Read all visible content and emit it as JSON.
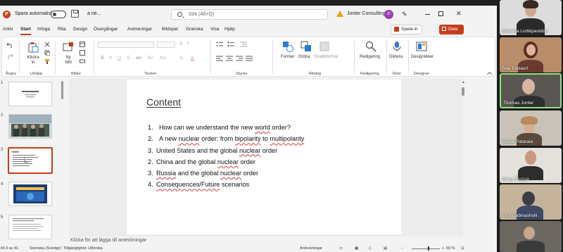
{
  "titlebar": {
    "autosave_label": "Spara automatiskt",
    "file_name": "a ne...",
    "search_placeholder": "Sök (Alt+Q)",
    "user_name": "Jonter Consulting",
    "user_initials": "JC"
  },
  "menu": {
    "tabs": [
      "Arkiv",
      "Start",
      "Infoga",
      "Rita",
      "Design",
      "Övergångar",
      "Animeringar",
      "Bildspel",
      "Granska",
      "Visa",
      "Hjälp"
    ],
    "active_tab": "Start",
    "present_label": "Spela in",
    "share_label": "Dela"
  },
  "ribbon": {
    "groups": [
      "Ångra",
      "Urklipp",
      "Bilder",
      "Tecken",
      "Stycke",
      "Ritning",
      "Redigering",
      "Röst",
      "Designer"
    ],
    "paste_label": "Klistra in",
    "new_slide_label": "Ny bild",
    "format_labels": [
      "B",
      "K",
      "U",
      "S",
      "ab",
      "AV"
    ],
    "shapes_label": "Former",
    "arrange_label": "Ordna",
    "quick_styles_label": "Snabbformat",
    "editing_label": "Redigering",
    "dictate_label": "Diktera",
    "designer_label": "Designidéer"
  },
  "thumbnails": {
    "numbers": [
      "1",
      "2",
      "3",
      "4",
      "5"
    ],
    "selected": 3
  },
  "slide": {
    "title": "Content",
    "items": [
      {
        "num": "1.",
        "parts": [
          [
            "",
            "How can we understand the new "
          ],
          [
            "sp",
            "world"
          ],
          [
            "",
            " order?"
          ]
        ]
      },
      {
        "num": "2.",
        "parts": [
          [
            "",
            "A new "
          ],
          [
            "sp",
            "nuclear"
          ],
          [
            "",
            " order: from "
          ],
          [
            "sp",
            "bipolarity"
          ],
          [
            "",
            " to "
          ],
          [
            "sp",
            "multipolarity"
          ]
        ]
      },
      {
        "num": "3.",
        "parts": [
          [
            "",
            "United States and the global "
          ],
          [
            "sp",
            "nuclear"
          ],
          [
            "",
            " order"
          ]
        ]
      },
      {
        "num": "2.",
        "parts": [
          [
            "",
            "China and the global "
          ],
          [
            "sp",
            "nuclear"
          ],
          [
            "",
            " order"
          ]
        ]
      },
      {
        "num": "3.",
        "parts": [
          [
            "sp",
            "Russia"
          ],
          [
            "",
            " and the global "
          ],
          [
            "sp",
            "nuclear"
          ],
          [
            "",
            " order"
          ]
        ]
      },
      {
        "num": "4.",
        "parts": [
          [
            "sp",
            "Consequences/Future"
          ],
          [
            "",
            " scenarios"
          ]
        ]
      }
    ]
  },
  "notes_placeholder": "Klicka för att lägga till anteckningar",
  "statusbar": {
    "slide_count": "ild 3 av 41",
    "language": "Svenska (Sverige)",
    "accessibility": "Tillgänglighet: Utforska",
    "notes": "Anteckningar",
    "zoom": "59 %"
  },
  "participants": [
    {
      "name": "Shorena Lortkipanidze"
    },
    {
      "name": "Tela Tsiklauri"
    },
    {
      "name": "Thomas Jonter"
    },
    {
      "name": "Tamar Pataraia"
    },
    {
      "name": "ლიკა მაკეკა"
    },
    {
      "name": "Irma Gabinashvili"
    }
  ]
}
